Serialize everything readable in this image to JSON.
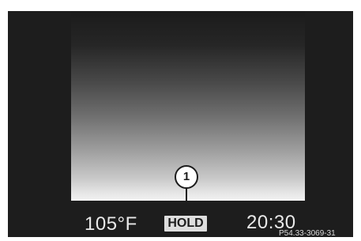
{
  "display": {
    "temperature": "105°F",
    "hold_label": "HOLD",
    "time": "20:30"
  },
  "callout": {
    "number": "1"
  },
  "reference": "P54.33-3069-31"
}
